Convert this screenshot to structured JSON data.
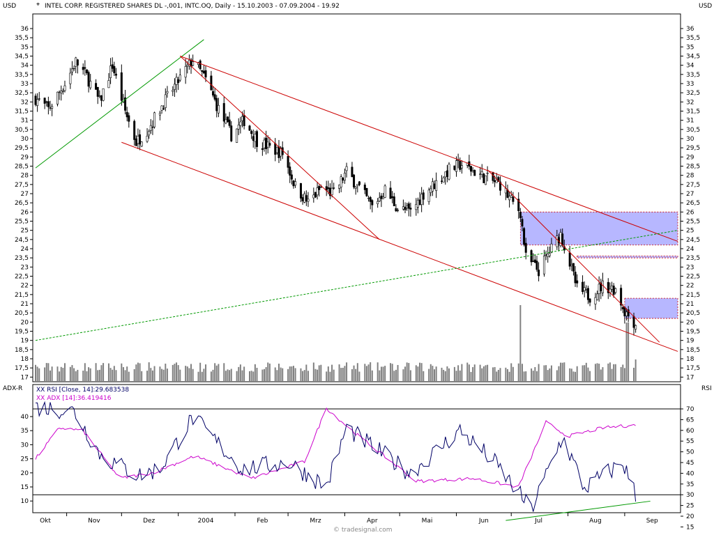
{
  "header": {
    "left_currency": "USD",
    "right_currency": "USD",
    "title": "INTEL CORP. REGISTERED SHARES DL -,001, INTC.OQ, Daily - 15.10.2003 - 07.09.2004 - 19.92"
  },
  "lower_panel": {
    "left_label": "ADX-R",
    "right_label": "RSI",
    "legend_rsi": "XX RSI [Close, 14]:29.683538",
    "legend_adx": "XX ADX [14]:36.419416"
  },
  "footer": {
    "watermark": "© tradesignal.com"
  },
  "colors": {
    "price": "#000000",
    "volume": "#808080",
    "channel": "#cc0000",
    "trend_up": "#009900",
    "box_fill": "#9999ff",
    "rsi": "#000066",
    "adx": "#cc00cc"
  },
  "chart_data": {
    "type": "candlestick",
    "symbol": "INTC.OQ",
    "interval": "Daily",
    "x_tick_labels": [
      "Okt",
      "Nov",
      "Dez",
      "2004",
      "Feb",
      "Mrz",
      "Apr",
      "Mai",
      "Jun",
      "Jul",
      "Aug",
      "Sep"
    ],
    "price_axis": {
      "ticks": [
        "36",
        "35,5",
        "35",
        "34,5",
        "34",
        "33,5",
        "33",
        "32,5",
        "32",
        "31,5",
        "31",
        "30,5",
        "30",
        "29,5",
        "29",
        "28,5",
        "28",
        "27,5",
        "27",
        "26,5",
        "26",
        "25,5",
        "25",
        "24,5",
        "24",
        "23,5",
        "23",
        "22,5",
        "22",
        "21,5",
        "21",
        "20,5",
        "20",
        "19,5",
        "19",
        "18,5",
        "18",
        "17,5",
        "17"
      ]
    },
    "close_anchors": [
      {
        "date": "2003-10-15",
        "close": 32.2
      },
      {
        "date": "2003-10-22",
        "close": 31.6
      },
      {
        "date": "2003-10-31",
        "close": 33.0
      },
      {
        "date": "2003-11-06",
        "close": 34.2
      },
      {
        "date": "2003-11-12",
        "close": 33.4
      },
      {
        "date": "2003-11-19",
        "close": 32.0
      },
      {
        "date": "2003-11-26",
        "close": 34.0
      },
      {
        "date": "2003-12-03",
        "close": 31.5
      },
      {
        "date": "2003-12-09",
        "close": 29.8
      },
      {
        "date": "2003-12-16",
        "close": 30.6
      },
      {
        "date": "2003-12-23",
        "close": 31.8
      },
      {
        "date": "2004-01-02",
        "close": 33.3
      },
      {
        "date": "2004-01-09",
        "close": 34.3
      },
      {
        "date": "2004-01-16",
        "close": 33.2
      },
      {
        "date": "2004-01-23",
        "close": 31.6
      },
      {
        "date": "2004-01-30",
        "close": 30.2
      },
      {
        "date": "2004-02-06",
        "close": 31.0
      },
      {
        "date": "2004-02-13",
        "close": 29.9
      },
      {
        "date": "2004-02-20",
        "close": 29.5
      },
      {
        "date": "2004-02-27",
        "close": 29.2
      },
      {
        "date": "2004-03-05",
        "close": 27.4
      },
      {
        "date": "2004-03-12",
        "close": 26.5
      },
      {
        "date": "2004-03-19",
        "close": 27.3
      },
      {
        "date": "2004-03-26",
        "close": 27.0
      },
      {
        "date": "2004-04-02",
        "close": 28.2
      },
      {
        "date": "2004-04-09",
        "close": 27.3
      },
      {
        "date": "2004-04-16",
        "close": 26.3
      },
      {
        "date": "2004-04-23",
        "close": 27.2
      },
      {
        "date": "2004-04-30",
        "close": 26.2
      },
      {
        "date": "2004-05-07",
        "close": 26.0
      },
      {
        "date": "2004-05-14",
        "close": 27.0
      },
      {
        "date": "2004-05-21",
        "close": 27.6
      },
      {
        "date": "2004-05-28",
        "close": 28.3
      },
      {
        "date": "2004-06-04",
        "close": 28.6
      },
      {
        "date": "2004-06-11",
        "close": 28.2
      },
      {
        "date": "2004-06-18",
        "close": 27.8
      },
      {
        "date": "2004-06-25",
        "close": 27.5
      },
      {
        "date": "2004-07-01",
        "close": 26.6
      },
      {
        "date": "2004-07-06",
        "close": 26.0
      },
      {
        "date": "2004-07-09",
        "close": 23.5
      },
      {
        "date": "2004-07-16",
        "close": 22.8
      },
      {
        "date": "2004-07-23",
        "close": 24.0
      },
      {
        "date": "2004-07-28",
        "close": 24.8
      },
      {
        "date": "2004-08-02",
        "close": 23.2
      },
      {
        "date": "2004-08-06",
        "close": 21.8
      },
      {
        "date": "2004-08-13",
        "close": 21.4
      },
      {
        "date": "2004-08-20",
        "close": 22.0
      },
      {
        "date": "2004-08-27",
        "close": 21.8
      },
      {
        "date": "2004-09-01",
        "close": 20.6
      },
      {
        "date": "2004-09-07",
        "close": 19.9
      }
    ],
    "last_close": 19.92,
    "rsi": {
      "name": "XX RSI [Close, 14]",
      "last": 29.683538,
      "levels": [
        70,
        30
      ],
      "axis_ticks": [
        "70",
        "65",
        "60",
        "55",
        "50",
        "45",
        "40",
        "35",
        "30",
        "25",
        "20",
        "15"
      ],
      "anchors": [
        [
          "2003-10-15",
          71
        ],
        [
          "2003-11-05",
          69
        ],
        [
          "2003-11-20",
          48
        ],
        [
          "2003-12-10",
          39
        ],
        [
          "2003-12-22",
          42
        ],
        [
          "2004-01-09",
          66
        ],
        [
          "2004-02-05",
          42
        ],
        [
          "2004-03-01",
          45
        ],
        [
          "2004-03-22",
          34
        ],
        [
          "2004-04-02",
          61
        ],
        [
          "2004-05-07",
          40
        ],
        [
          "2004-06-03",
          60
        ],
        [
          "2004-06-22",
          45
        ],
        [
          "2004-07-12",
          23
        ],
        [
          "2004-07-29",
          57
        ],
        [
          "2004-08-10",
          33
        ],
        [
          "2004-08-31",
          45
        ],
        [
          "2004-09-07",
          30
        ]
      ]
    },
    "adx": {
      "name": "XX ADX [14]",
      "last": 36.419416,
      "axis_ticks": [
        "40",
        "35",
        "30",
        "25",
        "20",
        "15",
        "10"
      ],
      "anchors": [
        [
          "2003-10-15",
          25
        ],
        [
          "2003-10-28",
          36
        ],
        [
          "2003-11-10",
          35
        ],
        [
          "2003-11-30",
          18
        ],
        [
          "2003-12-18",
          20
        ],
        [
          "2004-01-10",
          26
        ],
        [
          "2004-02-10",
          18
        ],
        [
          "2004-03-10",
          24
        ],
        [
          "2004-03-22",
          43
        ],
        [
          "2004-04-05",
          35
        ],
        [
          "2004-05-10",
          17
        ],
        [
          "2004-06-10",
          18
        ],
        [
          "2004-07-05",
          15
        ],
        [
          "2004-07-20",
          38
        ],
        [
          "2004-08-01",
          33
        ],
        [
          "2004-08-20",
          36
        ],
        [
          "2004-09-07",
          37
        ]
      ]
    },
    "drawn_lines": [
      {
        "kind": "uptrend",
        "style": "solid",
        "from": [
          "2003-10-15",
          28.4
        ],
        "to": [
          "2004-01-15",
          35.4
        ]
      },
      {
        "kind": "channel-top",
        "style": "solid",
        "from": [
          "2004-01-02",
          34.5
        ],
        "to": [
          "2004-09-30",
          24.4
        ]
      },
      {
        "kind": "channel-bottom",
        "style": "solid",
        "from": [
          "2003-12-01",
          29.8
        ],
        "to": [
          "2004-09-30",
          18.4
        ]
      },
      {
        "kind": "inner-fan",
        "style": "solid",
        "from": [
          "2004-01-02",
          34.5
        ],
        "to": [
          "2004-04-20",
          24.5
        ]
      },
      {
        "kind": "inner-fan-2",
        "style": "solid",
        "from": [
          "2004-06-18",
          28.3
        ],
        "to": [
          "2004-09-20",
          18.9
        ]
      },
      {
        "kind": "long-uptrend",
        "style": "dashed",
        "from": [
          "2003-10-15",
          19.0
        ],
        "to": [
          "2004-09-30",
          25.0
        ]
      }
    ],
    "zones": [
      {
        "from": "2004-07-06",
        "to": "2004-09-30",
        "top": 26.0,
        "bottom": 24.2
      },
      {
        "from": "2004-08-06",
        "to": "2004-09-30",
        "top": 23.6,
        "bottom": 23.5
      },
      {
        "from": "2004-09-01",
        "to": "2004-09-30",
        "top": 21.3,
        "bottom": 20.2
      }
    ],
    "volume_note": "volume histogram overlaid at bottom of price panel"
  }
}
